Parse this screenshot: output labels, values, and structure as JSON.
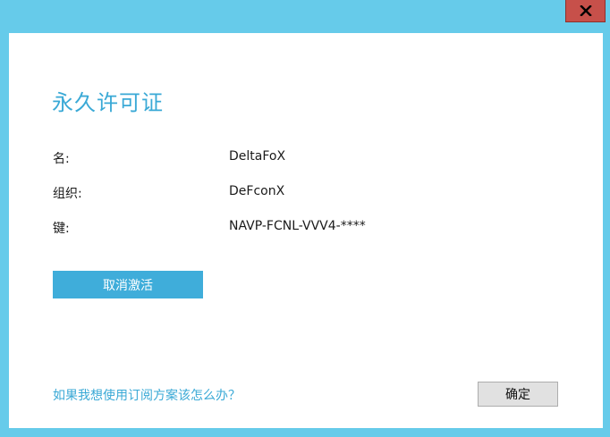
{
  "window": {
    "close_icon": "close-icon",
    "colors": {
      "frame": "#66cbea",
      "close_button": "#c7504a",
      "accent": "#3aa9d6"
    }
  },
  "license": {
    "title": "永久许可证",
    "rows": [
      {
        "label": "名:",
        "value": "DeltaFoX"
      },
      {
        "label": "组织:",
        "value": "DeFconX"
      },
      {
        "label": "键:",
        "value": "NAVP-FCNL-VVV4-****"
      }
    ],
    "deactivate_label": "取消激活",
    "help_link": "如果我想使用订阅方案该怎么办？",
    "ok_label": "确定"
  }
}
